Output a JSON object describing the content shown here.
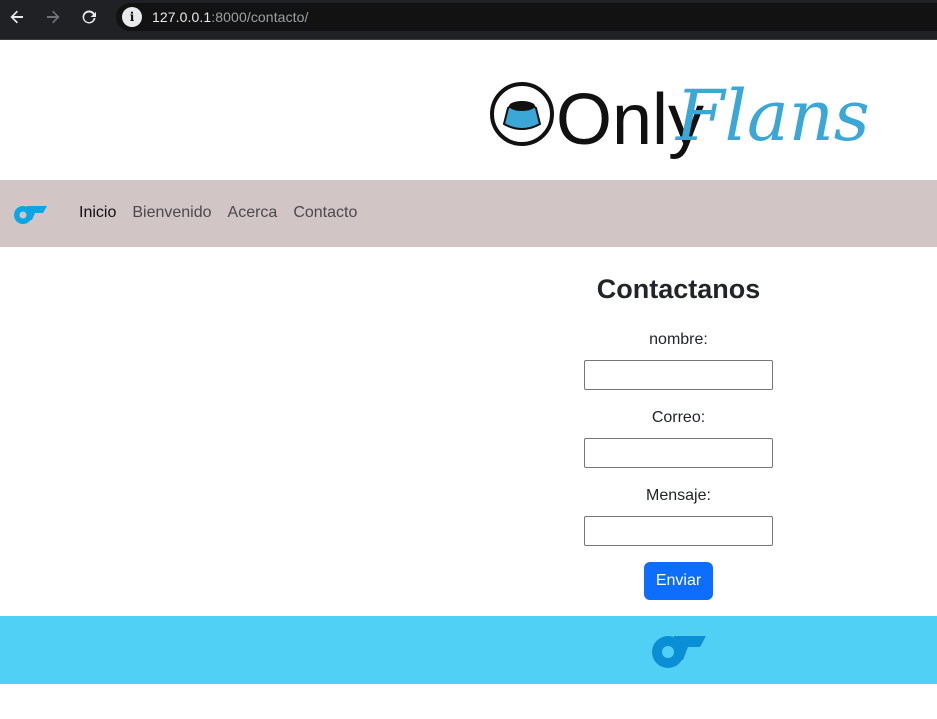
{
  "browser": {
    "url_host": "127.0.0.1",
    "url_path": ":8000/contacto/"
  },
  "header": {
    "logo_text_only": "Only",
    "logo_text_flans": "Flans"
  },
  "nav": {
    "items": [
      {
        "label": "Inicio",
        "active": true
      },
      {
        "label": "Bienvenido",
        "active": false
      },
      {
        "label": "Acerca",
        "active": false
      },
      {
        "label": "Contacto",
        "active": false
      }
    ]
  },
  "contact": {
    "title": "Contactanos",
    "fields": [
      {
        "label": "nombre:",
        "value": "",
        "placeholder": ""
      },
      {
        "label": "Correo:",
        "value": "",
        "placeholder": ""
      },
      {
        "label": "Mensaje:",
        "value": "",
        "placeholder": ""
      }
    ],
    "submit_label": "Enviar"
  },
  "colors": {
    "navbar_bg": "#d2c5c6",
    "footer_bg": "#51d0f5",
    "button_bg": "#0d6efd",
    "logo_blue": "#3ba7d6"
  },
  "icons": [
    "back-arrow-icon",
    "forward-arrow-icon",
    "reload-icon",
    "site-info-icon",
    "onlyfans-logo-icon",
    "flan-icon"
  ]
}
